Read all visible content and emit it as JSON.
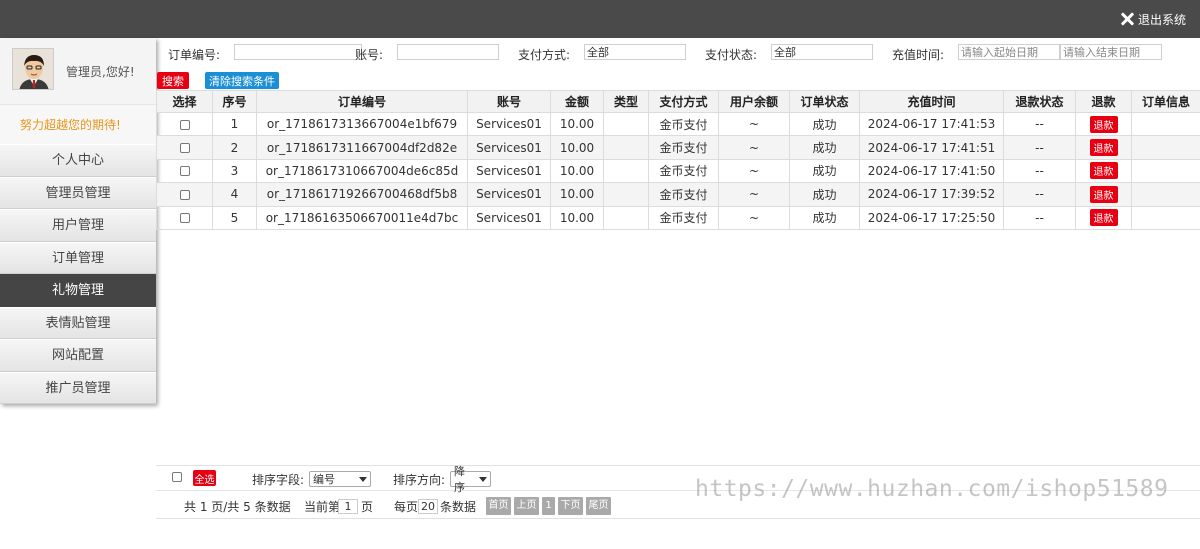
{
  "header": {
    "logout_label": "退出系统"
  },
  "sidebar": {
    "greeting": "管理员,您好!",
    "motto": "努力超越您的期待!",
    "items": [
      {
        "label": "个人中心"
      },
      {
        "label": "管理员管理"
      },
      {
        "label": "用户管理"
      },
      {
        "label": "订单管理"
      },
      {
        "label": "礼物管理",
        "active": true
      },
      {
        "label": "表情贴管理"
      },
      {
        "label": "网站配置"
      },
      {
        "label": "推广员管理"
      }
    ]
  },
  "filters": {
    "order_no_label": "订单编号:",
    "order_no_value": "",
    "account_label": "账号:",
    "account_value": "",
    "pay_method_label": "支付方式:",
    "pay_method_value": "全部",
    "pay_status_label": "支付状态:",
    "pay_status_value": "全部",
    "time_label": "充值时间:",
    "start_placeholder": "请输入起始日期",
    "end_placeholder": "请输入结束日期",
    "search_label": "搜索",
    "clear_label": "清除搜索条件"
  },
  "table": {
    "headers": [
      "选择",
      "序号",
      "订单编号",
      "账号",
      "金额",
      "类型",
      "支付方式",
      "用户余额",
      "订单状态",
      "充值时间",
      "退款状态",
      "退款",
      "订单信息"
    ],
    "refund_label": "退款",
    "rows": [
      {
        "seq": "1",
        "order_no": "or_1718617313667004e1bf679",
        "account": "Services01",
        "amount": "10.00",
        "type": "",
        "pay_method": "金币支付",
        "balance": "~",
        "status": "成功",
        "time": "2024-06-17 17:41:53",
        "refund_status": "--",
        "info": ""
      },
      {
        "seq": "2",
        "order_no": "or_1718617311667004df2d82e",
        "account": "Services01",
        "amount": "10.00",
        "type": "",
        "pay_method": "金币支付",
        "balance": "~",
        "status": "成功",
        "time": "2024-06-17 17:41:51",
        "refund_status": "--",
        "info": ""
      },
      {
        "seq": "3",
        "order_no": "or_1718617310667004de6c85d",
        "account": "Services01",
        "amount": "10.00",
        "type": "",
        "pay_method": "金币支付",
        "balance": "~",
        "status": "成功",
        "time": "2024-06-17 17:41:50",
        "refund_status": "--",
        "info": ""
      },
      {
        "seq": "4",
        "order_no": "or_171861719266700468df5b8",
        "account": "Services01",
        "amount": "10.00",
        "type": "",
        "pay_method": "金币支付",
        "balance": "~",
        "status": "成功",
        "time": "2024-06-17 17:39:52",
        "refund_status": "--",
        "info": ""
      },
      {
        "seq": "5",
        "order_no": "or_17186163506670011e4d7bc",
        "account": "Services01",
        "amount": "10.00",
        "type": "",
        "pay_method": "金币支付",
        "balance": "~",
        "status": "成功",
        "time": "2024-06-17 17:25:50",
        "refund_status": "--",
        "info": ""
      }
    ]
  },
  "footer": {
    "select_all_label": "全选",
    "sort_field_label": "排序字段:",
    "sort_field_value": "编号",
    "sort_dir_label": "排序方向:",
    "sort_dir_value": "降序",
    "summary": "共 1 页/共 5 条数据",
    "current_page_prefix": "当前第",
    "current_page": "1",
    "current_page_suffix": "页",
    "per_page_prefix": "每页",
    "per_page": "20",
    "per_page_suffix": "条数据",
    "first_label": "首页",
    "prev_label": "上页",
    "page_num": "1",
    "next_label": "下页",
    "last_label": "尾页"
  },
  "watermark": "https://www.huzhan.com/ishop51589",
  "colors": {
    "topbar": "#4a4a4a",
    "accent_red": "#e60012",
    "accent_blue": "#1a8fd6",
    "motto": "#e6951c"
  }
}
